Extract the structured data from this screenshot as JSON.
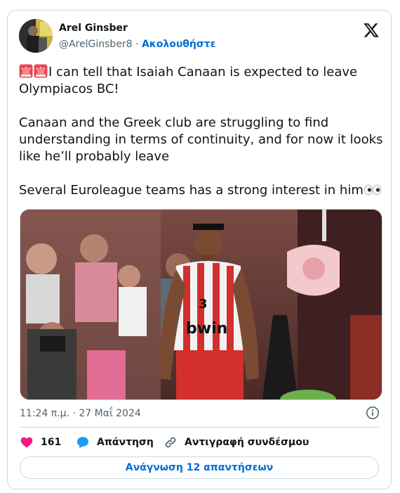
{
  "author": {
    "name": "Arel Ginsber",
    "handle": "@ArelGinsber8",
    "separator": "·",
    "follow_label": "Ακολουθήστε"
  },
  "tweet": {
    "line1": "I can tell that Isaiah Canaan is expected to leave Olympiacos BC!",
    "line2": "Canaan and the Greek club are struggling to find understanding in terms of continuity, and for now it looks like he’ll probably leave",
    "line3": "Several Euroleague teams has a strong interest in him",
    "emoji_start": "siren-emoji",
    "emoji_end": "eyes-emoji"
  },
  "media": {
    "jersey_number": "3",
    "jersey_sponsor": "bwin"
  },
  "timestamp": "11:24 π.μ. · 27 Μαΐ 2024",
  "actions": {
    "likes_count": "161",
    "reply_label": "Απάντηση",
    "copy_link_label": "Αντιγραφή συνδέσμου"
  },
  "read_replies_label": "Ανάγνωση 12 απαντήσεων",
  "colors": {
    "accent": "#006fd6",
    "like": "#f91880",
    "reply": "#1d9bf0",
    "border": "#cfd9de",
    "muted": "#536471"
  }
}
